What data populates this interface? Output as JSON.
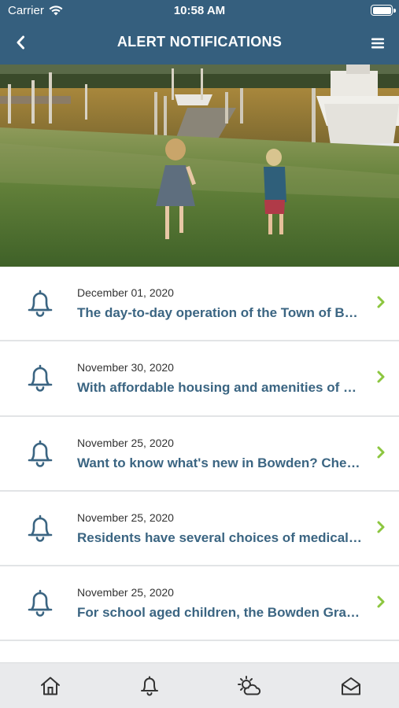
{
  "status_bar": {
    "carrier": "Carrier",
    "time": "10:58 AM"
  },
  "nav": {
    "title": "ALERT NOTIFICATIONS"
  },
  "hero": {
    "alt": "Children running on lawn by the docks"
  },
  "notifications": [
    {
      "date": "December 01, 2020",
      "text": "The day-to-day operation of the Town of Bowden is overseen by the Town Manager"
    },
    {
      "date": "November 30, 2020",
      "text": "With affordable housing and amenities of a larger town, Bowden offers something for everyone"
    },
    {
      "date": "November 25, 2020",
      "text": "Want to know what's new in Bowden? Check out the latest news"
    },
    {
      "date": "November 25, 2020",
      "text": "Residents have several choices of medical facilities close to home"
    },
    {
      "date": "November 25, 2020",
      "text": "For school aged children, the Bowden Grand School offers programs for all grades"
    }
  ],
  "tabs": [
    {
      "icon": "home-icon",
      "label": "Home"
    },
    {
      "icon": "bell-icon",
      "label": "Alerts"
    },
    {
      "icon": "weather-icon",
      "label": "Weather"
    },
    {
      "icon": "inbox-icon",
      "label": "Inbox"
    }
  ],
  "colors": {
    "primary": "#355f7e",
    "link": "#3b6582",
    "accent": "#8cc63f"
  }
}
